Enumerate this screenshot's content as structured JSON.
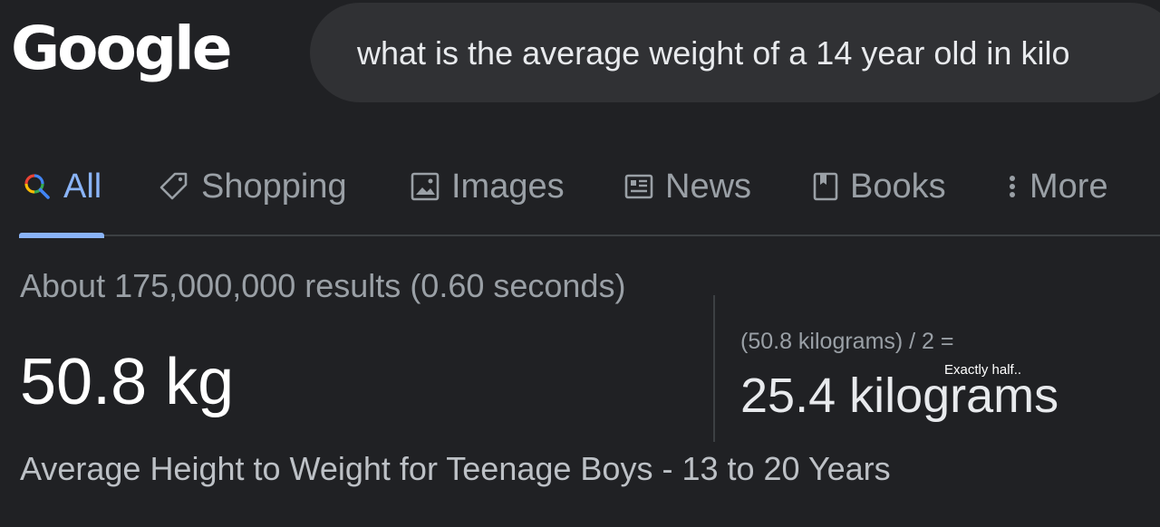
{
  "logo": {
    "text": "Google"
  },
  "search": {
    "query": "what is the average weight of a 14 year old in kilo"
  },
  "tabs": [
    {
      "label": "All",
      "icon": "search-icon",
      "active": true
    },
    {
      "label": "Shopping",
      "icon": "tag-icon"
    },
    {
      "label": "Images",
      "icon": "image-icon"
    },
    {
      "label": "News",
      "icon": "newspaper-icon"
    },
    {
      "label": "Books",
      "icon": "book-icon"
    },
    {
      "label": "More",
      "icon": "more-vertical-icon"
    }
  ],
  "results": {
    "stats": "About 175,000,000 results (0.60 seconds)",
    "answer": "50.8 kg",
    "title": "Average Height to Weight for Teenage Boys - 13 to 20 Years"
  },
  "calculator": {
    "expression": "(50.8 kilograms) / 2 =",
    "result": "25.4 kilograms"
  },
  "annotation": {
    "text": "Exactly half.."
  },
  "colors": {
    "background": "#202124",
    "search_box": "#303134",
    "accent": "#8ab4f8",
    "text_primary": "#e8eaed",
    "text_secondary": "#9aa0a6",
    "divider": "#3c4043"
  }
}
